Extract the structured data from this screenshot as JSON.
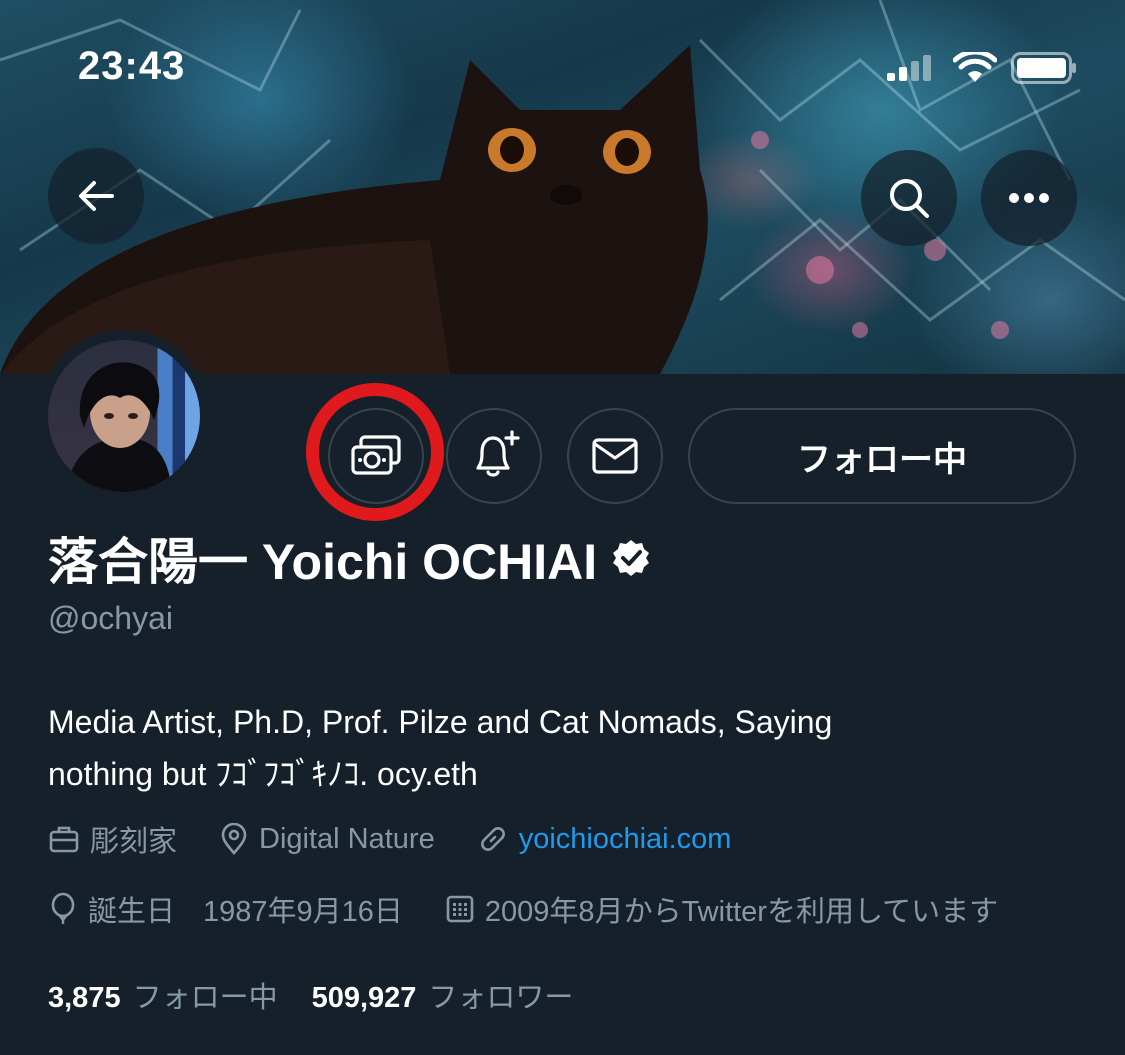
{
  "status_bar": {
    "time": "23:43"
  },
  "header": {
    "back_icon": "arrow-left-icon",
    "search_icon": "search-icon",
    "more_icon": "more-horizontal-icon"
  },
  "profile": {
    "name": "落合陽一 Yoichi OCHIAI",
    "verified": true,
    "handle": "@ochyai",
    "bio_line1": "Media Artist, Ph.D, Prof. Pilze and Cat Nomads, Saying",
    "bio_line2": "nothing but ﾌｺﾞﾌｺﾞｷﾉｺ.  ocy.eth",
    "profession": "彫刻家",
    "location": "Digital Nature",
    "website": "yoichiochiai.com",
    "birthday_label": "誕生日",
    "birthday": "1987年9月16日",
    "joined": "2009年8月からTwitterを利用しています"
  },
  "actions": {
    "tip_icon": "money-icon",
    "notify_icon": "bell-plus-icon",
    "message_icon": "mail-icon",
    "follow_label": "フォロー中"
  },
  "stats": {
    "following_count": "3,875",
    "following_label": "フォロー中",
    "followers_count": "509,927",
    "followers_label": "フォロワー"
  },
  "colors": {
    "background": "#15202b",
    "secondary_text": "#8899a6",
    "link": "#1d9bf0",
    "border": "#38444d",
    "highlight_ring": "#e0191c"
  }
}
